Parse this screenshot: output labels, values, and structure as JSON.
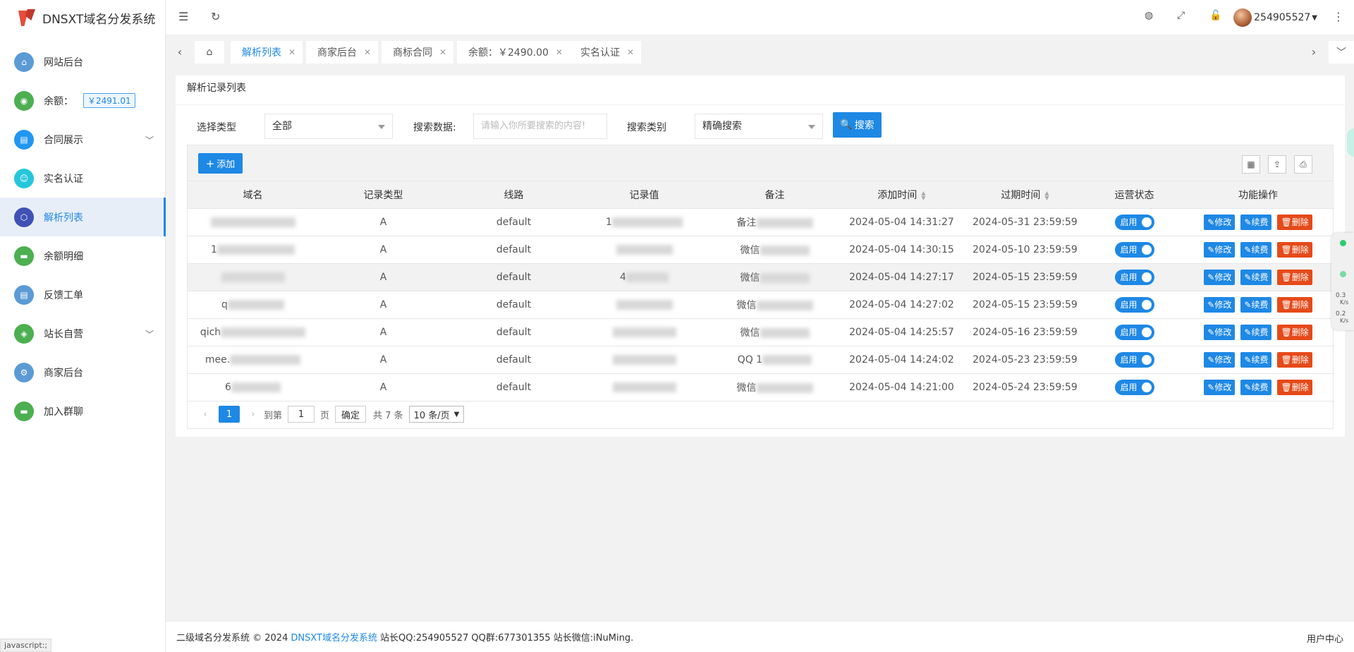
{
  "app": {
    "title": "DNSXT域名分发系统"
  },
  "sidebar": {
    "items": [
      {
        "label": "网站后台",
        "color": "#5b9bd5",
        "icon": "home-icon"
      },
      {
        "label": "余额：",
        "color": "#4caf50",
        "icon": "wallet-icon",
        "badge": "￥2491.01"
      },
      {
        "label": "合同展示",
        "color": "#2196f3",
        "icon": "document-icon",
        "expandable": true
      },
      {
        "label": "实名认证",
        "color": "#26c6da",
        "icon": "user-check-icon"
      },
      {
        "label": "解析列表",
        "color": "#3f51b5",
        "icon": "cube-icon",
        "active": true
      },
      {
        "label": "余额明细",
        "color": "#4caf50",
        "icon": "chat-icon"
      },
      {
        "label": "反馈工单",
        "color": "#5b9bd5",
        "icon": "ticket-icon"
      },
      {
        "label": "站长自营",
        "color": "#4caf50",
        "icon": "shop-icon",
        "expandable": true
      },
      {
        "label": "商家后台",
        "color": "#5b9bd5",
        "icon": "gear-icon"
      },
      {
        "label": "加入群聊",
        "color": "#4caf50",
        "icon": "group-chat-icon"
      }
    ]
  },
  "header": {
    "username": "254905527"
  },
  "tabs": [
    {
      "label": "解析列表",
      "active": true
    },
    {
      "label": "商家后台"
    },
    {
      "label": "商标合同"
    },
    {
      "label": "余额：￥2490.00"
    },
    {
      "label": "实名认证"
    }
  ],
  "card": {
    "title": "解析记录列表"
  },
  "filters": {
    "type_label": "选择类型",
    "type_value": "全部",
    "data_label": "搜索数据:",
    "data_placeholder": "请输入你所要搜索的内容!",
    "mode_label": "搜索类别",
    "mode_value": "精确搜索",
    "search_button": "搜索"
  },
  "toolbar": {
    "add_button": "添加"
  },
  "table": {
    "columns": [
      "域名",
      "记录类型",
      "线路",
      "记录值",
      "备注",
      "添加时间",
      "过期时间",
      "运营状态",
      "功能操作"
    ],
    "rows": [
      {
        "domain": "",
        "type": "A",
        "line": "default",
        "value": "1",
        "remark": "备注",
        "added": "2024-05-04 14:31:27",
        "expires": "2024-05-31 23:59:59",
        "status": "启用"
      },
      {
        "domain": "1",
        "type": "A",
        "line": "default",
        "value": "",
        "remark": "微信",
        "added": "2024-05-04 14:30:15",
        "expires": "2024-05-10 23:59:59",
        "status": "启用"
      },
      {
        "domain": "",
        "type": "A",
        "line": "default",
        "value": "4",
        "remark": "微信",
        "added": "2024-05-04 14:27:17",
        "expires": "2024-05-15 23:59:59",
        "status": "启用"
      },
      {
        "domain": "q",
        "type": "A",
        "line": "default",
        "value": "",
        "remark": "微信",
        "added": "2024-05-04 14:27:02",
        "expires": "2024-05-15 23:59:59",
        "status": "启用"
      },
      {
        "domain": "qich",
        "type": "A",
        "line": "default",
        "value": "",
        "remark": "微信",
        "added": "2024-05-04 14:25:57",
        "expires": "2024-05-16 23:59:59",
        "status": "启用"
      },
      {
        "domain": "mee.",
        "type": "A",
        "line": "default",
        "value": "",
        "remark": "QQ 1",
        "added": "2024-05-04 14:24:02",
        "expires": "2024-05-23 23:59:59",
        "status": "启用"
      },
      {
        "domain": "6",
        "type": "A",
        "line": "default",
        "value": "",
        "remark": "微信",
        "added": "2024-05-04 14:21:00",
        "expires": "2024-05-24 23:59:59",
        "status": "启用"
      }
    ],
    "actions": {
      "edit": "修改",
      "renew": "续费",
      "delete": "删除"
    }
  },
  "pagination": {
    "current": "1",
    "goto_label": "到第",
    "goto_value": "1",
    "page_suffix": "页",
    "confirm": "确定",
    "total": "共 7 条",
    "per_page": "10 条/页"
  },
  "footer": {
    "prefix": "二级域名分发系统 © 2024",
    "link": "DNSXT域名分发系统",
    "suffix": "站长QQ:254905527 QQ群:677301355 站长微信:iNuMing.",
    "right": "用户中心"
  },
  "status_bar": "javascript:;",
  "net_widget": {
    "up": "0.3",
    "down": "0.2",
    "unit": "K/s"
  }
}
